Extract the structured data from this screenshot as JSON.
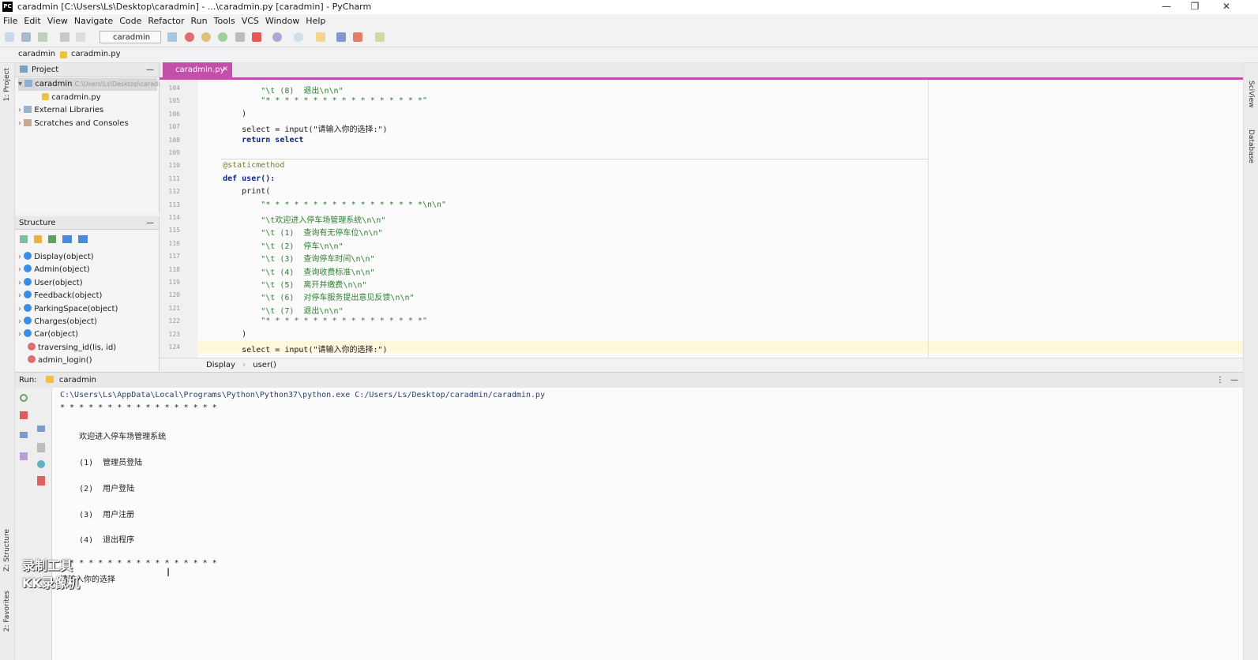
{
  "window": {
    "title": "caradmin [C:\\Users\\Ls\\Desktop\\caradmin] - ...\\caradmin.py [caradmin] - PyCharm",
    "logo": "PC",
    "controls": [
      "—",
      "❐",
      "✕"
    ]
  },
  "menu": [
    "File",
    "Edit",
    "View",
    "Navigate",
    "Code",
    "Refactor",
    "Run",
    "Tools",
    "VCS",
    "Window",
    "Help"
  ],
  "toolbar": {
    "run_config": "caradmin"
  },
  "navbar": {
    "project": "caradmin",
    "file": "caradmin.py"
  },
  "left_strip": {
    "project": "1: Project",
    "structure": "Z: Structure",
    "favorites": "2: Favorites"
  },
  "right_strip": {
    "sciview": "SciView",
    "database": "Database"
  },
  "project_panel": {
    "title": "Project",
    "root": "caradmin",
    "root_path": "C:\\Users\\Ls\\Desktop\\caradmin",
    "file": "caradmin.py",
    "external": "External Libraries",
    "scratches": "Scratches and Consoles"
  },
  "structure_panel": {
    "title": "Structure",
    "items": [
      {
        "name": "Display(object)",
        "kind": "class"
      },
      {
        "name": "Admin(object)",
        "kind": "class"
      },
      {
        "name": "User(object)",
        "kind": "class"
      },
      {
        "name": "Feedback(object)",
        "kind": "class"
      },
      {
        "name": "ParkingSpace(object)",
        "kind": "class"
      },
      {
        "name": "Charges(object)",
        "kind": "class"
      },
      {
        "name": "Car(object)",
        "kind": "class"
      },
      {
        "name": "traversing_id(lis, id)",
        "kind": "function"
      },
      {
        "name": "admin_login()",
        "kind": "function"
      }
    ]
  },
  "editor": {
    "tab": "caradmin.py",
    "lines": [
      {
        "n": "104",
        "text": "            \"\\t (8)  退出\\n\\n\"",
        "cls": "str"
      },
      {
        "n": "105",
        "text": "            \"* * * * * * * * * * * * * * * * *\"",
        "cls": "str"
      },
      {
        "n": "106",
        "text": "        )",
        "cls": ""
      },
      {
        "n": "107",
        "text": "        select = input(\"请输入你的选择:\")",
        "cls": ""
      },
      {
        "n": "108",
        "text": "        return select",
        "cls": "kwline"
      },
      {
        "n": "109",
        "text": "",
        "cls": ""
      },
      {
        "n": "110",
        "text": "    @staticmethod",
        "cls": "deco"
      },
      {
        "n": "111",
        "text": "    def user():",
        "cls": "kwline"
      },
      {
        "n": "112",
        "text": "        print(",
        "cls": ""
      },
      {
        "n": "113",
        "text": "            \"* * * * * * * * * * * * * * * * *\\n\\n\"",
        "cls": "str"
      },
      {
        "n": "114",
        "text": "            \"\\t欢迎进入停车场管理系统\\n\\n\"",
        "cls": "str"
      },
      {
        "n": "115",
        "text": "            \"\\t (1)  查询有无停车位\\n\\n\"",
        "cls": "str"
      },
      {
        "n": "116",
        "text": "            \"\\t (2)  停车\\n\\n\"",
        "cls": "str"
      },
      {
        "n": "117",
        "text": "            \"\\t (3)  查询停车时间\\n\\n\"",
        "cls": "str"
      },
      {
        "n": "118",
        "text": "            \"\\t (4)  查询收费标准\\n\\n\"",
        "cls": "str"
      },
      {
        "n": "119",
        "text": "            \"\\t (5)  离开并缴费\\n\\n\"",
        "cls": "str"
      },
      {
        "n": "120",
        "text": "            \"\\t (6)  对停车服务提出意见反馈\\n\\n\"",
        "cls": "str"
      },
      {
        "n": "121",
        "text": "            \"\\t (7)  退出\\n\\n\"",
        "cls": "str"
      },
      {
        "n": "122",
        "text": "            \"* * * * * * * * * * * * * * * * *\"",
        "cls": "str"
      },
      {
        "n": "123",
        "text": "        )",
        "cls": ""
      },
      {
        "n": "124",
        "text": "        select = input(\"请输入你的选择:\")",
        "cls": ""
      }
    ],
    "breadcrumb": [
      "Display",
      "user()"
    ]
  },
  "run_panel": {
    "label": "Run:",
    "config": "caradmin",
    "output": [
      "C:\\Users\\Ls\\AppData\\Local\\Programs\\Python\\Python37\\python.exe C:/Users/Ls/Desktop/caradmin/caradmin.py",
      "* * * * * * * * * * * * * * * * *",
      "",
      "    欢迎进入停车场管理系统",
      "",
      "    (1)  管理员登陆",
      "",
      "    (2)  用户登陆",
      "",
      "    (3)  用户注册",
      "",
      "    (4)  退出程序",
      "",
      "* * * * * * * * * * * * * * * * *",
      "请输入你的选择"
    ]
  },
  "watermark": [
    "录制工具",
    "KK录像机"
  ],
  "colors": {
    "accent": "#c24fa8",
    "string": "#2e7d32",
    "keyword": "#0d2a8a",
    "highlight": "#fdf7dc"
  }
}
